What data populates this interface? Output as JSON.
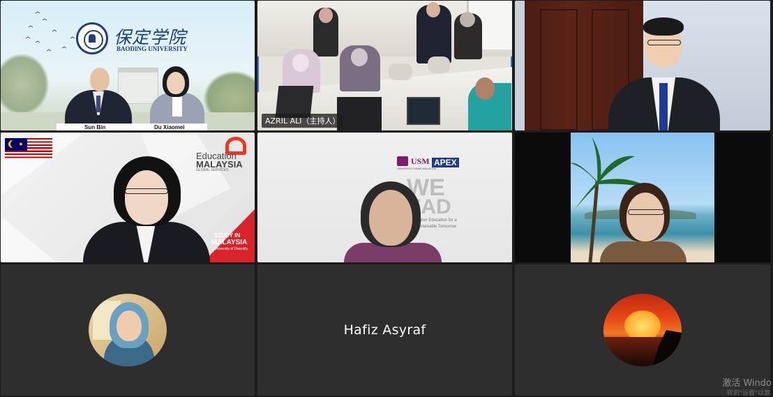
{
  "tiles": {
    "t1": {
      "university_cn": "保定学院",
      "university_en": "BAODING UNIVERSITY",
      "names": [
        "Sun Bin",
        "Du Xiaomei"
      ]
    },
    "t2": {
      "name_tag": "AZRIL ALI（主持人）"
    },
    "t4": {
      "brand_top": "Education",
      "brand_mid": "MALAYSIA",
      "brand_small": "GLOBAL SERVICES",
      "study_in": "STUDY IN",
      "study_country": "MALAYSIA",
      "study_sub": "University of Diversity"
    },
    "t5": {
      "logo1": "USM",
      "logo1_sub": "UNIVERSITI SAINS MALAYSIA",
      "logo2": "APEX",
      "we": "WE",
      "lead": "LEAD",
      "tagline1": "Higher Education for a",
      "tagline2": "Sustainable Tomorrow"
    },
    "t8": {
      "name": "Hafiz Asyraf"
    }
  },
  "watermark": {
    "line1": "激活 Windo",
    "line2": "转到\"设置\"以激"
  },
  "colors": {
    "active_border": "#3a6fd8",
    "tile_bg": "#2e2e2e",
    "app_bg": "#1c1c1c"
  }
}
